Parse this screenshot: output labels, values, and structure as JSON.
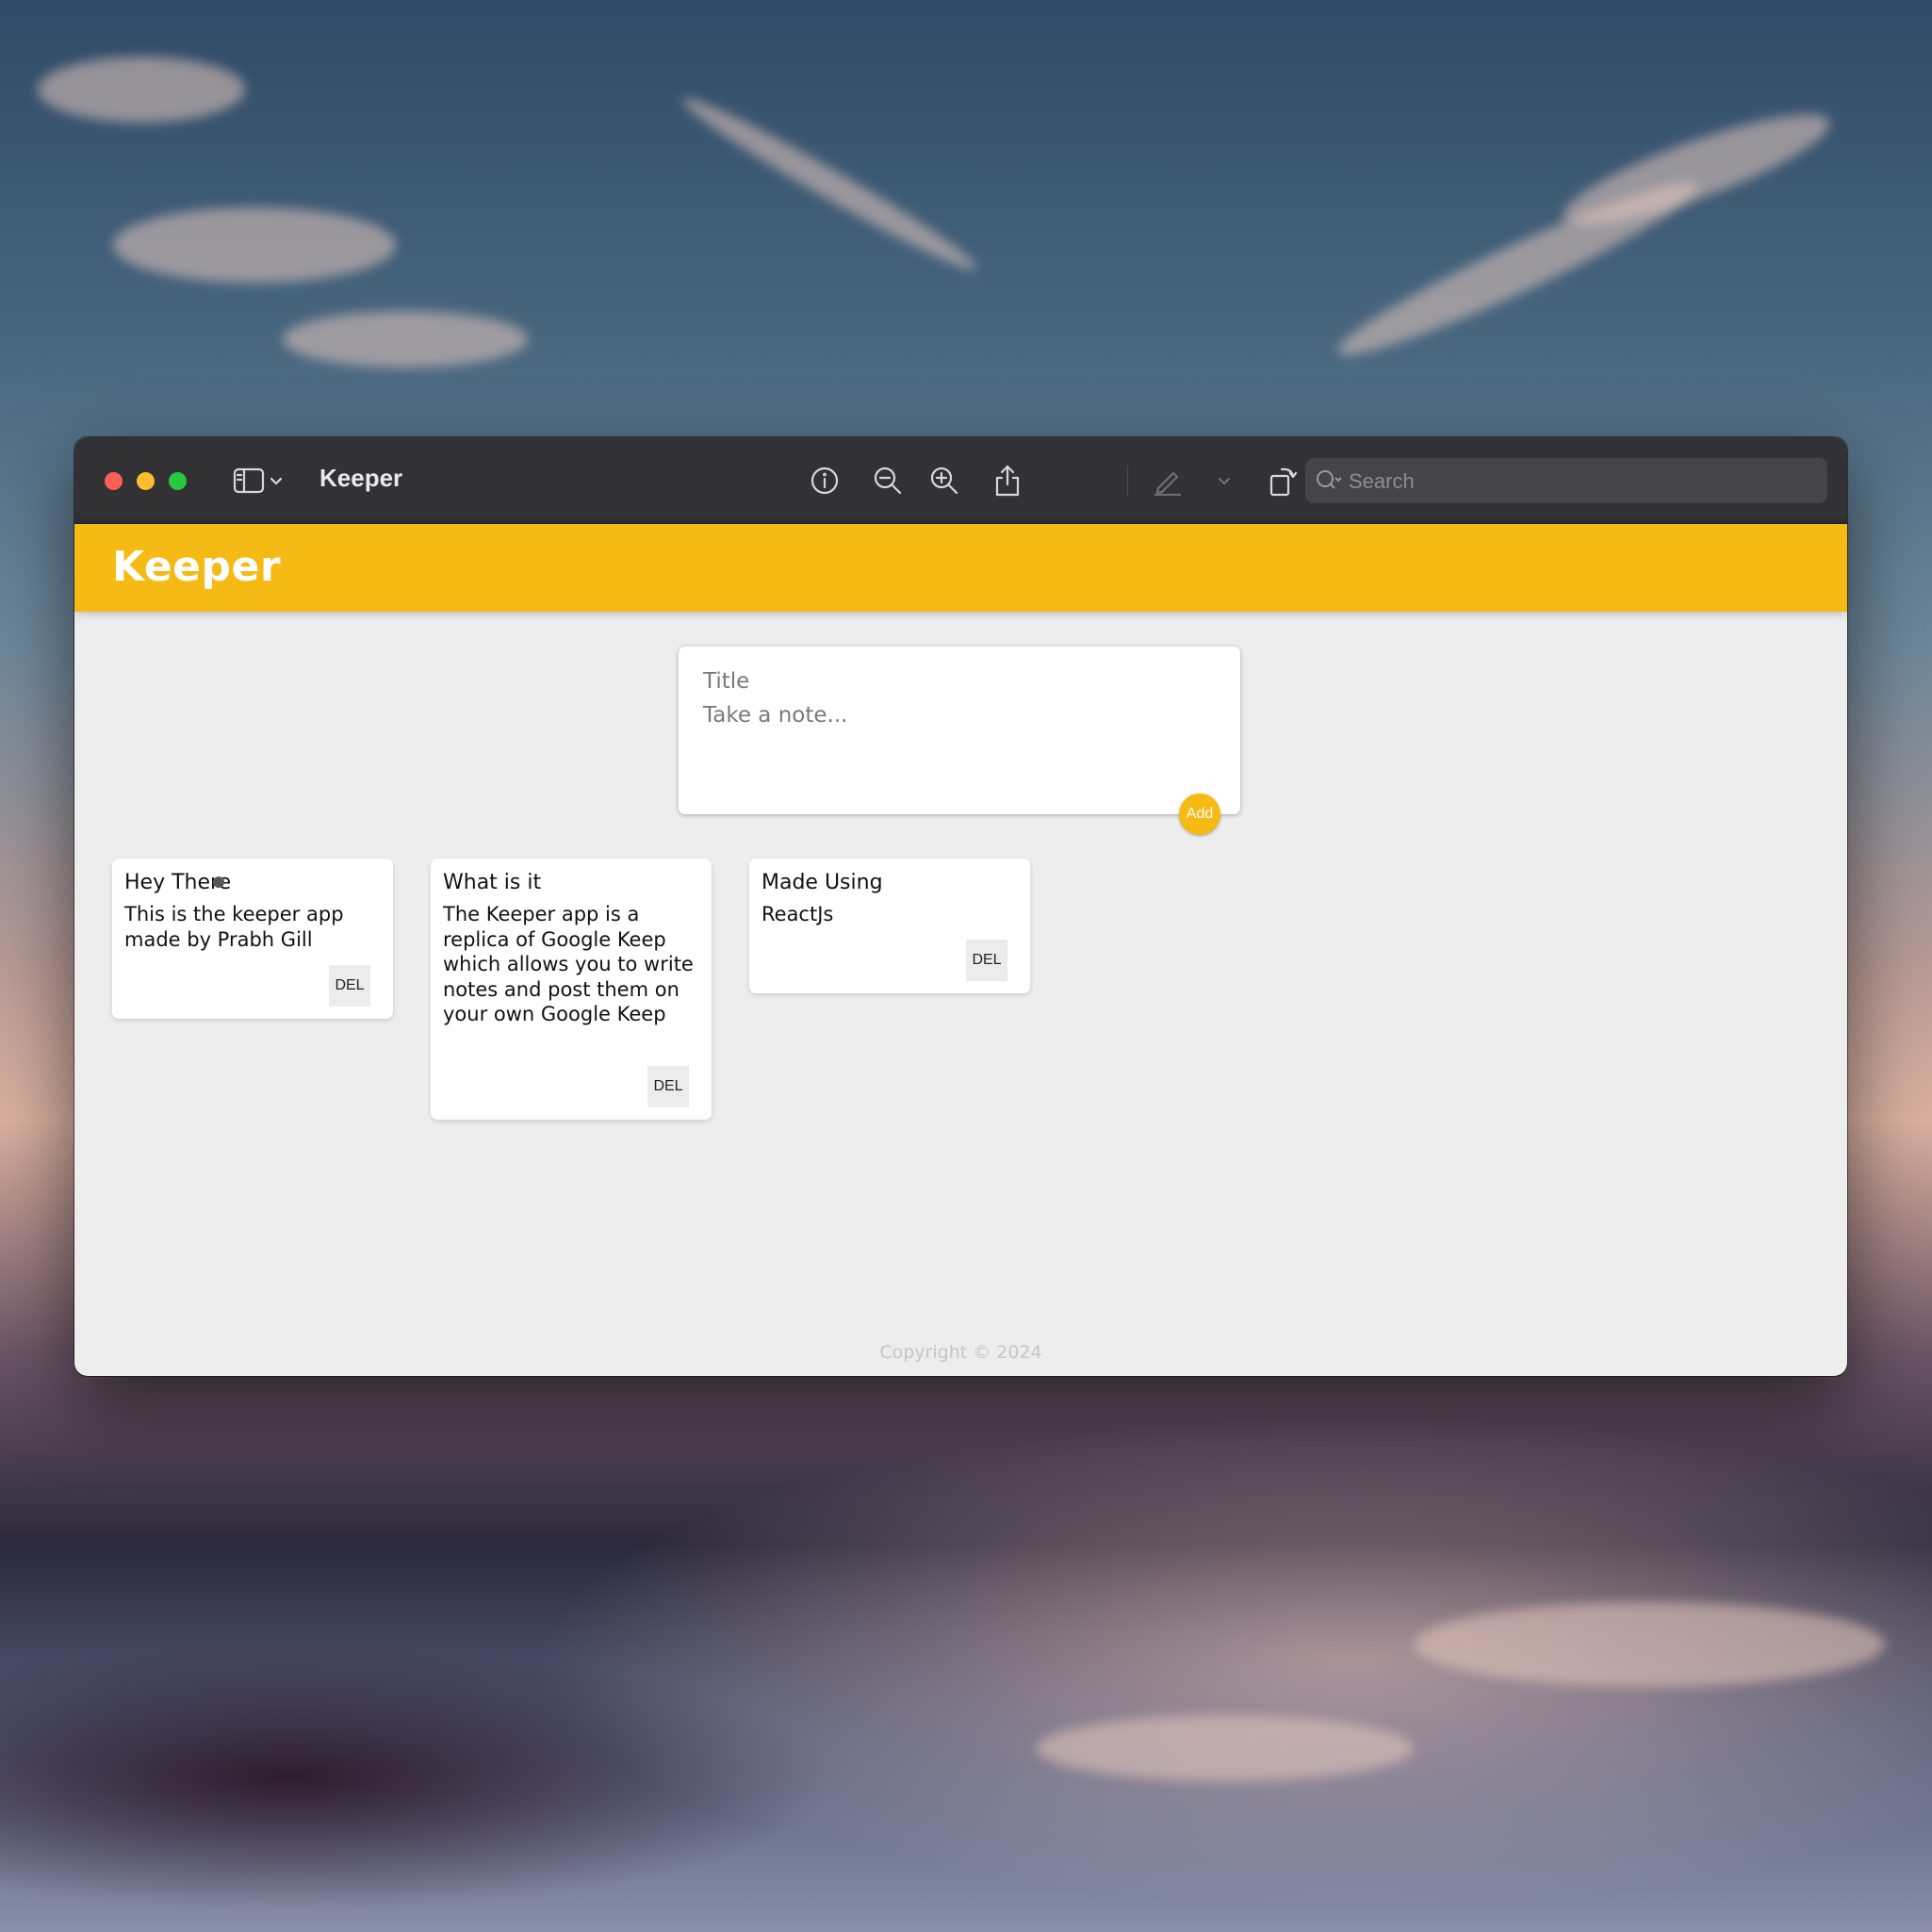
{
  "window": {
    "title": "Keeper",
    "search_placeholder": "Search"
  },
  "toolbar": {
    "icons": [
      "sidebar-icon",
      "chevron-down-icon",
      "info-icon",
      "zoom-out-icon",
      "zoom-in-icon",
      "share-icon",
      "markup-pen-icon",
      "chevron-down-icon",
      "rotate-icon",
      "annotate-icon",
      "search-icon"
    ]
  },
  "app": {
    "header_title": "Keeper",
    "accent_color": "#f5ba13",
    "create_note": {
      "title_placeholder": "Title",
      "content_placeholder": "Take a note...",
      "add_label": "Add"
    },
    "notes": [
      {
        "title": "Hey There",
        "content": "This is the keeper app made by Prabh Gill",
        "delete_label": "DEL"
      },
      {
        "title": "What is it",
        "content": "The Keeper app is a replica of Google Keep which allows you to write notes and post them on your own Google Keep",
        "delete_label": "DEL"
      },
      {
        "title": "Made Using",
        "content": "ReactJs",
        "delete_label": "DEL"
      }
    ],
    "footer": "Copyright © 2024"
  }
}
